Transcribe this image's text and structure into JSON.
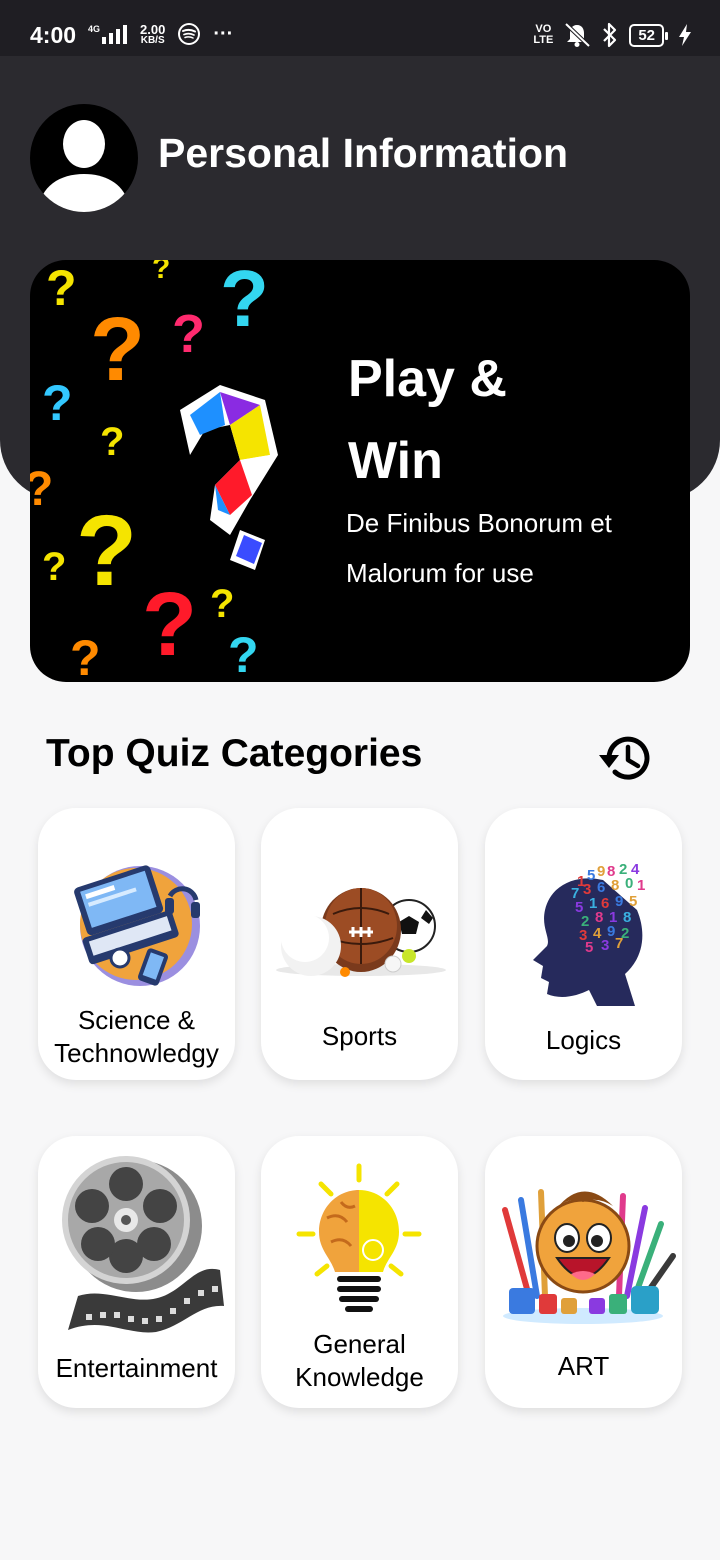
{
  "status_bar": {
    "time": "4:00",
    "network": "4G",
    "speed_value": "2.00",
    "speed_unit": "KB/S",
    "volte_top": "VO",
    "volte_bottom": "LTE",
    "battery": "52",
    "more": "···"
  },
  "profile": {
    "title": "Personal Information"
  },
  "banner": {
    "headline_line1": "Play &",
    "headline_line2": "Win",
    "subtitle_line1": "De Finibus Bonorum et",
    "subtitle_line2": "Malorum for use"
  },
  "categories_section": {
    "title": "Top Quiz Categories",
    "history_icon": "history-icon"
  },
  "categories": [
    {
      "label_line1": "Science &",
      "label_line2": "Technowledgy",
      "icon": "laptop-icon"
    },
    {
      "label_line1": "Sports",
      "icon": "sports-balls-icon"
    },
    {
      "label_line1": "Logics",
      "icon": "head-numbers-icon"
    },
    {
      "label_line1": "Entertainment",
      "icon": "film-reel-icon"
    },
    {
      "label_line1": "General",
      "label_line2": "Knowledge",
      "icon": "brain-bulb-icon"
    },
    {
      "label_line1": "ART",
      "icon": "art-supplies-icon"
    }
  ],
  "colors": {
    "header_bg": "#2b2a2f",
    "status_bg": "#1f1e23",
    "page_bg": "#f7f7f8",
    "banner_bg": "#000000"
  }
}
